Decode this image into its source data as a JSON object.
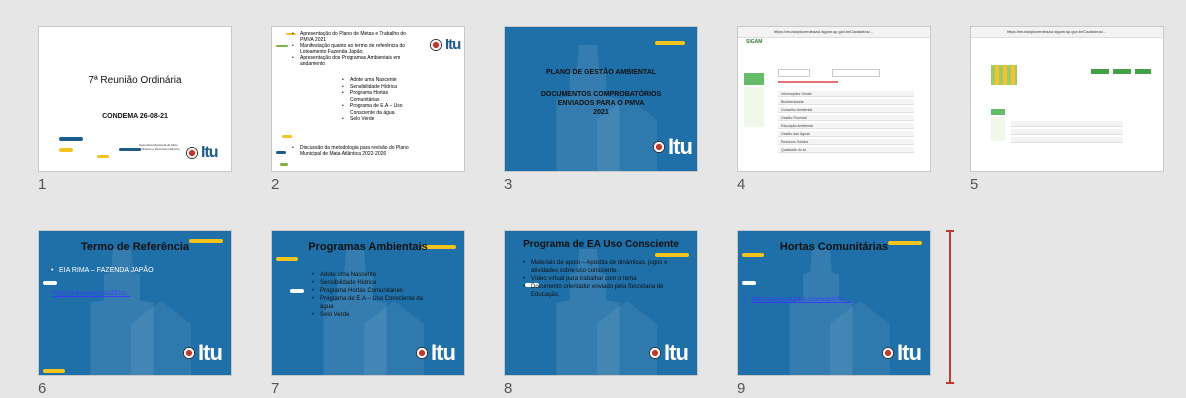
{
  "slides": [
    {
      "number": "1",
      "title": "7ª Reunião Ordinária",
      "subtitle": "CONDEMA 26-08-21",
      "secretaria": "Secretaria Municipal de Meio Ambiente e Recursos Hídricos"
    },
    {
      "number": "2",
      "bullets": [
        "Apresentação do Plano de Metas e Trabalho do PMVA 2021",
        "Manifestação quanto ao termo de referência do Loteamento Fazenda Japão;",
        "Apresentação dos Programas Ambientais em andamento"
      ],
      "subbullets": [
        "Adote uma Nascente",
        "Sensibilidade Hídrica",
        "Programa Hortas Comunitárias",
        "Programa de E.A – Uso Consciente da água",
        "Selo Verde"
      ],
      "last_bullet": "Discussão da metodologia para revisão do Plano Municipal de Mata Atlântica 2022-2026"
    },
    {
      "number": "3",
      "title_lines": [
        "PLANO DE GESTÃO AMBIENTAL",
        "DOCUMENTOS COMPROBATÓRIOS",
        "ENVIADOS PARA O PMVA",
        "2021"
      ]
    },
    {
      "number": "4",
      "url": "https://municipioverdeazul.sigam.sp.gov.br/Cadastros/...",
      "brand": "SIGAM",
      "rows": [
        "Informações Gerais",
        "Biodiversidade",
        "Conselho Ambiental",
        "Gestão Florestal",
        "Educação Ambiental",
        "Gestão das Águas",
        "Resíduos Sólidos",
        "Qualidade do Ar"
      ]
    },
    {
      "number": "5",
      "url": "https://municipioverdeazul.sigam.sp.gov.br/Cadastros/..."
    },
    {
      "number": "6",
      "title": "Termo de Referência",
      "bullet": "EIA RIMA – FAZENDA JAPÃO",
      "link": "https://1drv.ms/f/s!AmZKXz..."
    },
    {
      "number": "7",
      "title": "Programas Ambientais",
      "items": [
        "Adote uma Nascente",
        "Sensibilidade Hídrica",
        "Programa Hortas Comunitárias",
        "Programa de E.A – Uso Consciente da água",
        "Selo Verde"
      ]
    },
    {
      "number": "8",
      "title": "Programa de EA Uso Consciente",
      "items": [
        "Materiais de apoio – Apostila de dinâmicas, jogos e atividades sobre uso consciente.",
        "Vídeo virtual para trabalhar com o tema",
        "Documento orientador enviado pela Secretaria de Educação."
      ]
    },
    {
      "number": "9",
      "title": "Hortas Comunitárias",
      "link": "https://www.youtube.com/watch?v=..."
    }
  ],
  "logo_text": "Itu",
  "logo_tag": "TERRA DE CRESCER"
}
